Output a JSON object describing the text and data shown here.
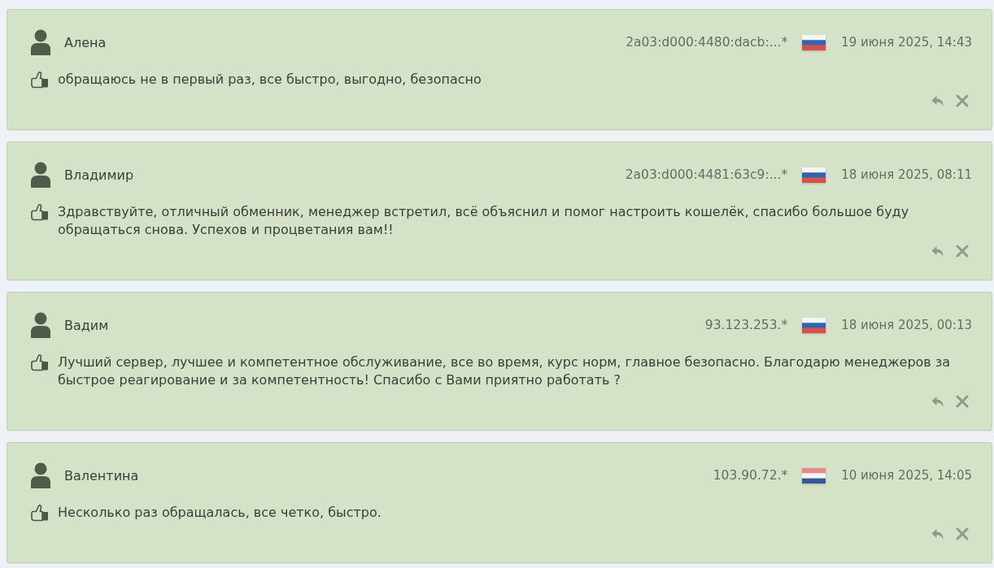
{
  "reviews": [
    {
      "author": "Алена",
      "ip": "2a03:d000:4480:dacb:...*",
      "flag": {
        "kind": "ru"
      },
      "date": "19 июня 2025, 14:43",
      "text": "обращаюсь не в первый раз, все быстро, выгодно, безопасно"
    },
    {
      "author": "Владимир",
      "ip": "2a03:d000:4481:63c9:...*",
      "flag": {
        "kind": "ru"
      },
      "date": "18 июня 2025, 08:11",
      "text": "Здравствуйте, отличный обменник, менеджер встретил, всё объяснил и помог настроить кошелёк, спасибо большое буду обращаться снова. Успехов и процветания вам!!"
    },
    {
      "author": "Вадим",
      "ip": "93.123.253.*",
      "flag": {
        "kind": "ru"
      },
      "date": "18 июня 2025, 00:13",
      "text": "Лучший сервер, лучшее и компетентное обслуживание, все во время, курс норм, главное безопасно. Благодарю менеджеров за быстрое реагирование и за компетентность! Спасибо с Вами приятно работать ?"
    },
    {
      "author": "Валентина",
      "ip": "103.90.72.*",
      "flag": {
        "kind": "nl"
      },
      "date": "10 июня 2025, 14:05",
      "text": "Несколько раз обращалась, все четко, быстро."
    }
  ]
}
